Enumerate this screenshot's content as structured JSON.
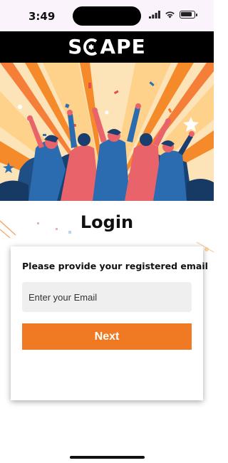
{
  "status_bar": {
    "time": "3:49",
    "icons": [
      "cellular-signal-icon",
      "wifi-icon",
      "battery-icon"
    ]
  },
  "header": {
    "logo_text_left": "S",
    "logo_text_right": "APE",
    "background": "#000000"
  },
  "login": {
    "title": "Login",
    "prompt": "Please provide your registered email",
    "email_placeholder": "Enter your Email",
    "next_label": "Next"
  },
  "colors": {
    "accent": "#f07a23",
    "input_bg": "#efefef"
  }
}
